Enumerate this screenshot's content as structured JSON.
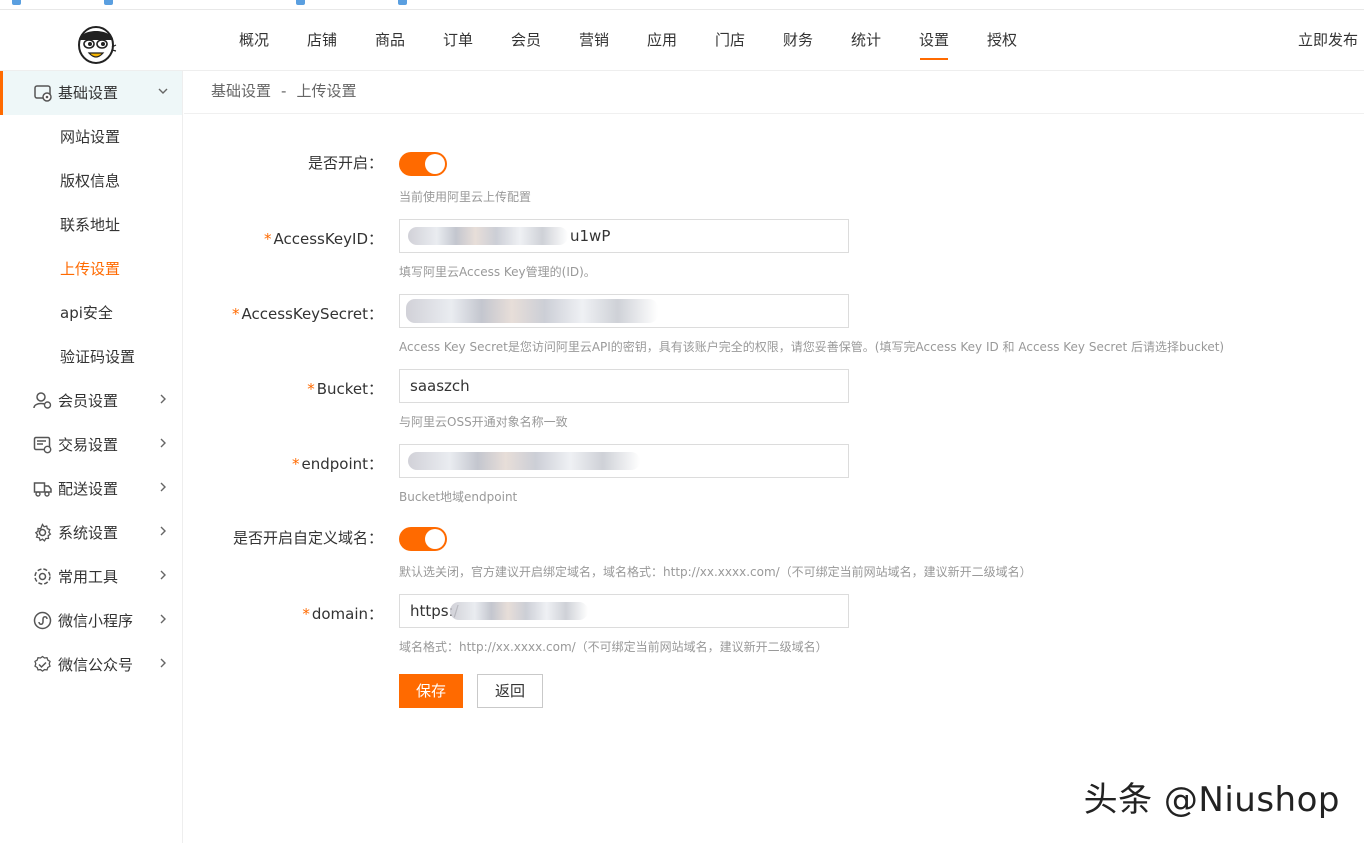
{
  "header": {
    "nav": [
      "概况",
      "店铺",
      "商品",
      "订单",
      "会员",
      "营销",
      "应用",
      "门店",
      "财务",
      "统计",
      "设置",
      "授权"
    ],
    "active_nav": "设置",
    "publish_label": "立即发布"
  },
  "sidebar": {
    "groups": [
      {
        "label": "基础设置",
        "icon": "settings-basic-icon",
        "open": true,
        "items": [
          "网站设置",
          "版权信息",
          "联系地址",
          "上传设置",
          "api安全",
          "验证码设置"
        ],
        "active_item": "上传设置"
      },
      {
        "label": "会员设置",
        "icon": "member-icon"
      },
      {
        "label": "交易设置",
        "icon": "trade-icon"
      },
      {
        "label": "配送设置",
        "icon": "delivery-icon"
      },
      {
        "label": "系统设置",
        "icon": "gear-icon"
      },
      {
        "label": "常用工具",
        "icon": "tools-icon"
      },
      {
        "label": "微信小程序",
        "icon": "mini-program-icon"
      },
      {
        "label": "微信公众号",
        "icon": "wechat-official-icon"
      }
    ]
  },
  "breadcrumb": {
    "parent": "基础设置",
    "separator": "-",
    "current": "上传设置"
  },
  "form": {
    "enable": {
      "label": "是否开启：",
      "on": true,
      "hint": "当前使用阿里云上传配置"
    },
    "access_key_id": {
      "label": "AccessKeyID：",
      "value": "u1wP",
      "hint": "填写阿里云Access Key管理的(ID)。"
    },
    "access_key_secret": {
      "label": "AccessKeySecret：",
      "hint": "Access Key Secret是您访问阿里云API的密钥，具有该账户完全的权限，请您妥善保管。(填写完Access Key ID 和 Access Key Secret 后请选择bucket)"
    },
    "bucket": {
      "label": "Bucket：",
      "value": "saaszch",
      "hint": "与阿里云OSS开通对象名称一致"
    },
    "endpoint": {
      "label": "endpoint：",
      "hint": "Bucket地域endpoint"
    },
    "custom_domain": {
      "label": "是否开启自定义域名：",
      "on": true,
      "hint": "默认选关闭，官方建议开启绑定域名，域名格式：http://xx.xxxx.com/（不可绑定当前网站域名，建议新开二级域名）"
    },
    "domain": {
      "label": "domain：",
      "value": "https:/",
      "hint": "域名格式：http://xx.xxxx.com/（不可绑定当前网站域名，建议新开二级域名）"
    },
    "required_mark": "*",
    "save_label": "保存",
    "back_label": "返回"
  },
  "watermark": "头条 @Niushop",
  "colors": {
    "accent": "#ff6a00",
    "sidebar_active_bg": "#eef7f8",
    "hint": "#999999"
  }
}
